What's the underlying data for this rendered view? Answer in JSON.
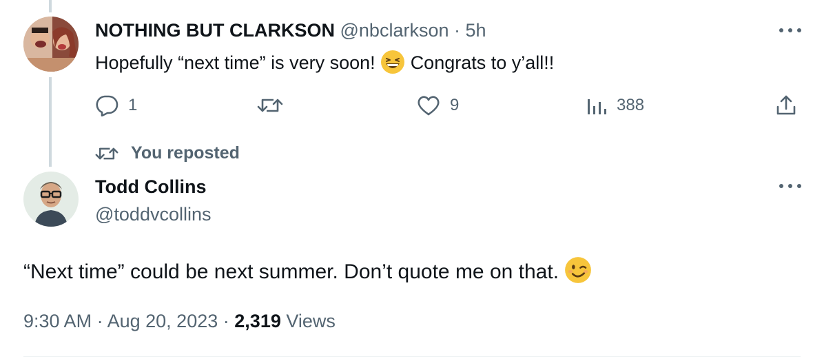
{
  "reply_tweet": {
    "display_name": "NOTHING BUT CLARKSON",
    "handle": "@nbclarkson",
    "separator": "·",
    "time": "5h",
    "text_before_emoji": "Hopefully “next time” is very soon!",
    "emoji": "grinning-squinting-face",
    "text_after_emoji": "Congrats to y’all!!",
    "actions": {
      "replies": "1",
      "reposts": "",
      "likes": "9",
      "views": "388"
    }
  },
  "repost_label": "You reposted",
  "main_tweet": {
    "display_name": "Todd Collins",
    "handle": "@toddvcollins",
    "text": "“Next time” could be next summer. Don’t quote me on that.",
    "emoji": "winking-face",
    "time": "9:30 AM",
    "date": "Aug 20, 2023",
    "separator": "·",
    "views_count": "2,319",
    "views_label": "Views"
  },
  "colors": {
    "text": "#0f1419",
    "muted": "#536471",
    "thread_line": "#cfd9de",
    "emoji_yellow": "#f7c53b"
  }
}
